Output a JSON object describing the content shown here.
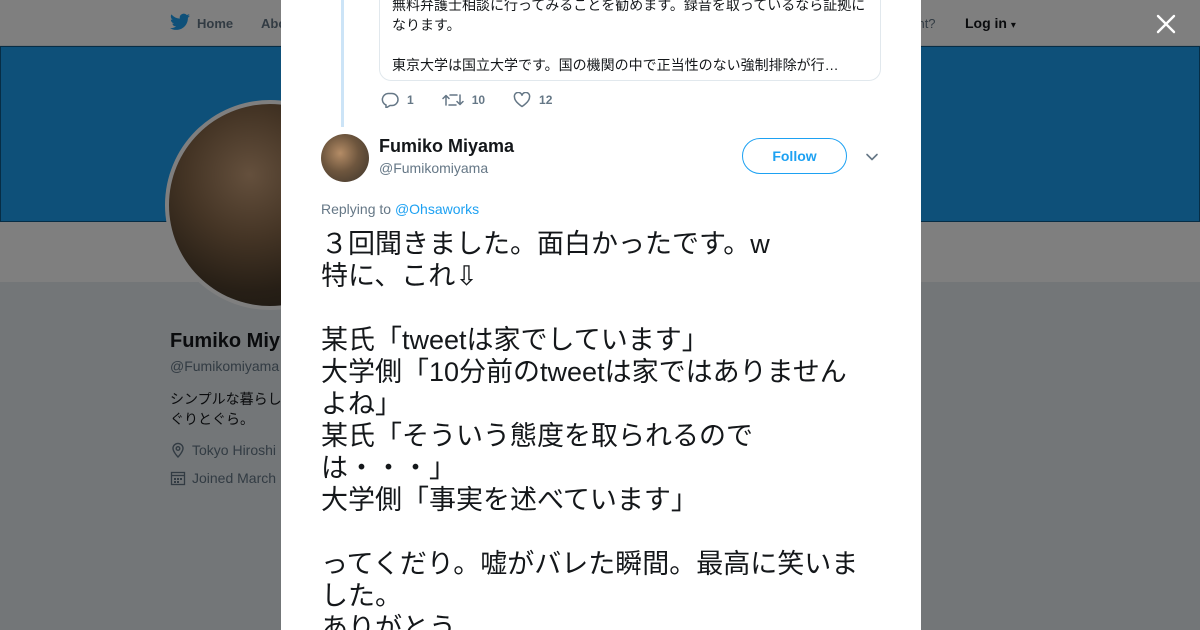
{
  "nav": {
    "home": "Home",
    "about": "Abo",
    "account": "ccount?",
    "login": "Log in"
  },
  "profile": {
    "name": "Fumiko Miy",
    "handle": "@Fumikomiyama",
    "bio_line1": "シンプルな暮らし",
    "bio_line2": "ぐりとぐら。",
    "location": "Tokyo Hiroshi",
    "joined": "Joined March"
  },
  "quote": {
    "line1": "無料弁護士相談に行ってみることを勧めます。録音を取っているなら証拠に",
    "line2": "なります。",
    "line3": "東京大学は国立大学です。国の機関の中で正当性のない強制排除が行…"
  },
  "actions": {
    "replies": "1",
    "retweets": "10",
    "likes": "12"
  },
  "tweet": {
    "name": "Fumiko Miyama",
    "handle": "@Fumikomiyama",
    "follow": "Follow",
    "replying_prefix": "Replying to",
    "replying_to": "@Ohsaworks",
    "lines": [
      "３回聞きました。面白かったです。w",
      "特に、これ⇩",
      "",
      "某氏「tweetは家でしています」",
      "大学側「10分前のtweetは家ではありません",
      "よね」",
      "某氏「そういう態度を取られるので",
      "は・・・」",
      "大学側「事実を述べています」",
      "",
      "ってくだり。嘘がバレた瞬間。最高に笑いま",
      "した。",
      "ありがとう。"
    ]
  },
  "colors": {
    "accent": "#1da1f2",
    "text": "#14171a",
    "muted": "#657786"
  }
}
